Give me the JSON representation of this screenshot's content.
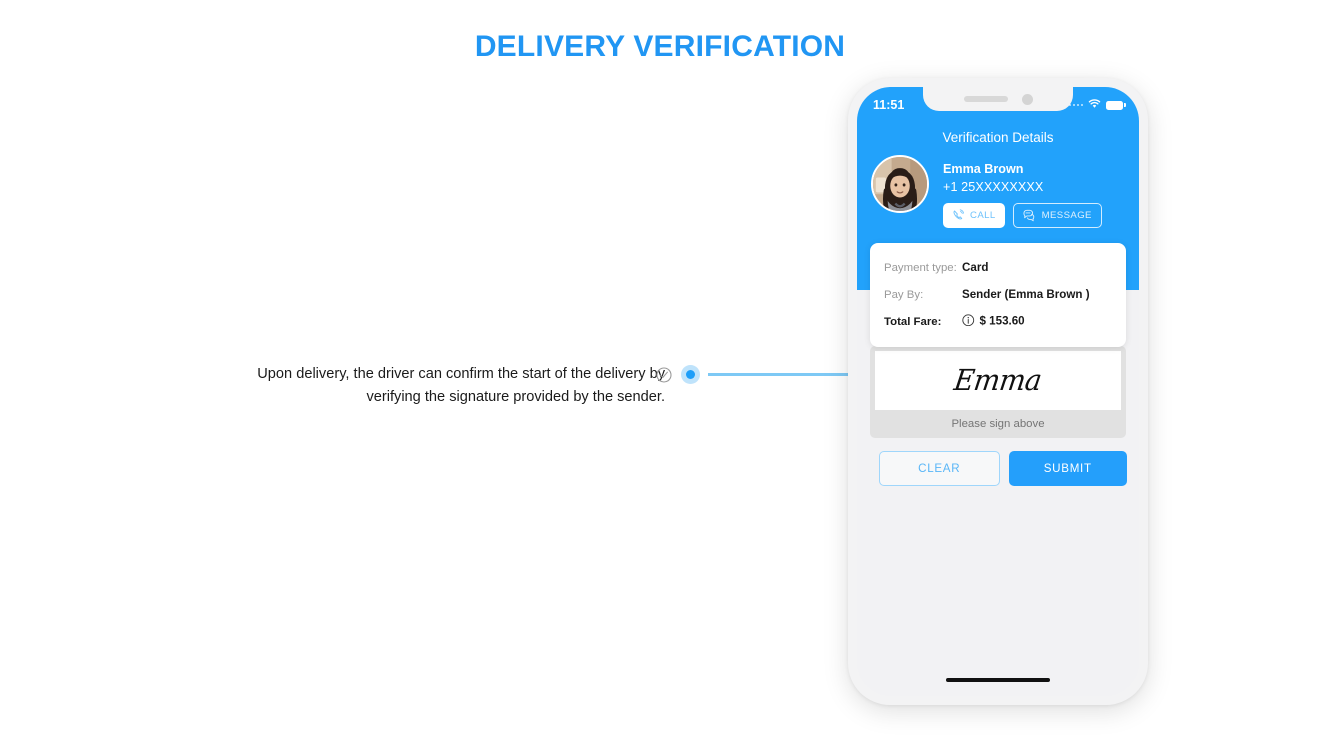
{
  "page": {
    "title": "DELIVERY VERIFICATION",
    "title_color": "#2196f3"
  },
  "caption": {
    "line1": "Upon delivery, the driver can confirm the start of the delivery by",
    "line2": "verifying the signature provided by the sender.",
    "check_icon": "check-circle-icon",
    "marker_icon": "connector-dot"
  },
  "phone": {
    "status_bar": {
      "time": "11:51",
      "signal_icon": "signal-dots-icon",
      "wifi_icon": "wifi-icon",
      "battery_icon": "battery-full-icon"
    },
    "screen_title": "Verification Details",
    "contact": {
      "avatar": "user-avatar",
      "name": "Emma Brown",
      "phone": "+1 25XXXXXXXX",
      "call_label": "CALL",
      "call_icon": "phone-icon",
      "message_label": "MESSAGE",
      "message_icon": "chat-bubbles-icon"
    },
    "payment": {
      "rows": [
        {
          "label": "Payment type:",
          "value": "Card",
          "bold_label": false,
          "has_info": false
        },
        {
          "label": "Pay By:",
          "value": "Sender (Emma Brown )",
          "bold_label": false,
          "has_info": false
        },
        {
          "label": "Total Fare:",
          "value": "$ 153.60",
          "bold_label": true,
          "has_info": true
        }
      ],
      "info_icon": "info-circle-icon"
    },
    "signature": {
      "value": "Emma",
      "hint": "Please sign above"
    },
    "actions": {
      "clear_label": "CLEAR",
      "submit_label": "SUBMIT"
    },
    "home_indicator": "home-indicator"
  },
  "colors": {
    "accent": "#22a2fb",
    "submit": "#249ffb",
    "clear_border": "#9fd6fb",
    "connector": "#7ec9f5"
  }
}
